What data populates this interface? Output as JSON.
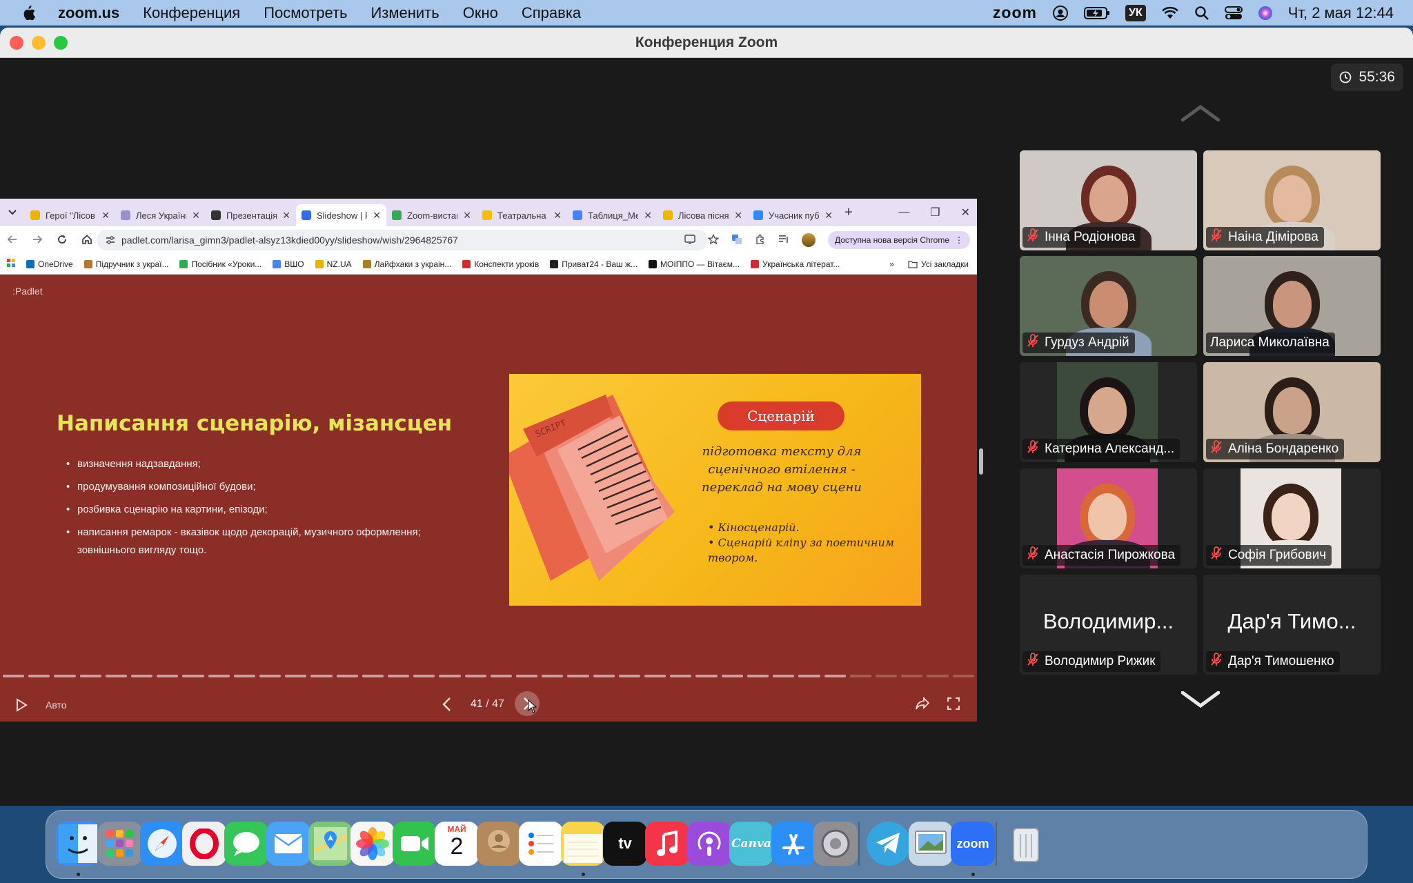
{
  "menubar": {
    "app_name": "zoom.us",
    "menu": [
      "Конференция",
      "Посмотреть",
      "Изменить",
      "Окно",
      "Справка"
    ],
    "status": {
      "zoom_label": "zoom",
      "keyboard": "УК",
      "datetime": "Чт, 2 мая  12:44"
    }
  },
  "window": {
    "title": "Конференция Zoom",
    "timer": "55:36"
  },
  "chrome": {
    "tabs": [
      {
        "title": "Герої \"Лісов",
        "color": "#f0b400",
        "active": false
      },
      {
        "title": "Леся Українк",
        "color": "#9a8fd0",
        "active": false
      },
      {
        "title": "Презентація",
        "color": "#333333",
        "active": false
      },
      {
        "title": "Slideshow | P",
        "color": "#2e6ee6",
        "active": true
      },
      {
        "title": "Zoom-вистав",
        "color": "#34a853",
        "active": false
      },
      {
        "title": "Театральна",
        "color": "#fbbc04",
        "active": false
      },
      {
        "title": "Таблиця_Ме",
        "color": "#4285f4",
        "active": false
      },
      {
        "title": "Лісова пісня",
        "color": "#f4b400",
        "active": false
      },
      {
        "title": "Учасник пуб",
        "color": "#2d8cff",
        "active": false
      }
    ],
    "url": "padlet.com/larisa_gimn3/padlet-alsyz13kdied00yy/slideshow/wish/2964825767",
    "update_chip": "Доступна нова версія Chrome",
    "bookmarks": [
      {
        "label": "OneDrive",
        "color": "#0f6cbd"
      },
      {
        "label": "Підручник з украї...",
        "color": "#b07a2a"
      },
      {
        "label": "Посібник «Уроки...",
        "color": "#34a853"
      },
      {
        "label": "ВШО",
        "color": "#4285f4"
      },
      {
        "label": "NZ.UA",
        "color": "#e8b400"
      },
      {
        "label": "Лайфхаки з украін...",
        "color": "#b07a2a"
      },
      {
        "label": "Конспекти уроків",
        "color": "#d12b2b"
      },
      {
        "label": "Приват24 - Ваш ж...",
        "color": "#222222"
      },
      {
        "label": "МОІППО — Вітаєм...",
        "color": "#111111"
      },
      {
        "label": "Українська літерат...",
        "color": "#d12b2b"
      }
    ],
    "bookmarks_all": "Усі закладки"
  },
  "slide": {
    "logo": ":Padlet",
    "heading": "Написання сценарію, мізансцен",
    "bullets": [
      "визначення надзавдання;",
      "продумування композиційної будови;",
      "розбивка сценарію на картини, епізоди;",
      "написання ремарок - вказівок щодо декорацій, музичного оформлення; зовнішнього вигляду тощо."
    ],
    "image": {
      "script_label": "SCRIPT",
      "badge": "Сценарій",
      "text": "підготовка тексту для сценічного втілення - переклад на мову сцени",
      "list": [
        "Кіносценарій.",
        "Сценарій кліпу за поетичним твором."
      ]
    },
    "auto_label": "Авто",
    "current": "41",
    "separator": " / ",
    "total": "47",
    "progress": 0.87
  },
  "participants": [
    {
      "name": "Інна Родіонова",
      "muted": true,
      "bg": "#cfcac6",
      "skin": "#d9a58c",
      "hair": "#6b2a22",
      "shirt": "#3d2a2a"
    },
    {
      "name": "Наіна Дімірова",
      "muted": true,
      "bg": "#d8c9bb",
      "skin": "#e3b9a0",
      "hair": "#b98a5a",
      "shirt": "#d9d0c8"
    },
    {
      "name": "Гурдуз Андрій",
      "muted": true,
      "bg": "#5c6a58",
      "skin": "#c98e72",
      "hair": "#3a2a22",
      "shirt": "#8da0b8"
    },
    {
      "name": "Лариса Миколаївна",
      "muted": false,
      "bg": "#a8a39a",
      "skin": "#c9957c",
      "hair": "#2e211c",
      "shirt": "#1f2230",
      "active": true
    },
    {
      "name": "Катерина Александ...",
      "muted": true,
      "bg": "#262626",
      "skin": "#d7a78c",
      "hair": "#1c1414",
      "shirt": "#101010",
      "photo": true,
      "photo_bg": "#3b4a3a"
    },
    {
      "name": "Аліна Бондаренко",
      "muted": true,
      "bg": "#cbb8a6",
      "skin": "#caa189",
      "hair": "#2c1d18",
      "shirt": "#9c8f84"
    },
    {
      "name": "Анастасія Пирожкова",
      "muted": true,
      "bg": "#262626",
      "skin": "#f0c4a8",
      "hair": "#d8683a",
      "shirt": "#3a2438",
      "photo": true,
      "photo_bg": "#d34e8c"
    },
    {
      "name": "Софія Грибович",
      "muted": true,
      "bg": "#262626",
      "skin": "#f2d4c4",
      "hair": "#3a2218",
      "shirt": "#ece6e2",
      "photo": true,
      "photo_bg": "#e9e4e0"
    },
    {
      "name": "Володимир Рижик",
      "muted": true,
      "big": "Володимир..."
    },
    {
      "name": "Дар'я Тимошенко",
      "muted": true,
      "big": "Дар'я Тимо..."
    }
  ],
  "dock": {
    "calendar_month": "МАЙ",
    "calendar_day": "2",
    "tv_label": "tv",
    "canva_label": "Canva",
    "zoom_label": "zoom",
    "apps": [
      {
        "name": "finder-icon",
        "color": "#3d8ef0",
        "running": true
      },
      {
        "name": "launchpad-icon",
        "color": "#8a8f9c",
        "running": false
      },
      {
        "name": "safari-icon",
        "color": "#2b8ff5",
        "running": false
      },
      {
        "name": "opera-icon",
        "color": "#f0f0f0",
        "running": false
      },
      {
        "name": "messages-icon",
        "color": "#35c659",
        "running": false
      },
      {
        "name": "mail-icon",
        "color": "#4aa3f7",
        "running": false
      },
      {
        "name": "maps-icon",
        "color": "#7ec77a",
        "running": false
      },
      {
        "name": "photos-icon",
        "color": "#f6f6f6",
        "running": false
      },
      {
        "name": "facetime-icon",
        "color": "#33c24d",
        "running": false
      },
      {
        "name": "calendar-icon",
        "color": "#ffffff",
        "running": false
      },
      {
        "name": "contacts-icon",
        "color": "#b48a5c",
        "running": false
      },
      {
        "name": "reminders-icon",
        "color": "#ffffff",
        "running": false
      },
      {
        "name": "notes-icon",
        "color": "#f7d54b",
        "running": true
      },
      {
        "name": "apple-tv-icon",
        "color": "#111111",
        "running": false
      },
      {
        "name": "music-icon",
        "color": "#f5344a",
        "running": false
      },
      {
        "name": "podcasts-icon",
        "color": "#9b4bdc",
        "running": false
      },
      {
        "name": "canva-icon",
        "color": "#4ac0d6",
        "running": false
      },
      {
        "name": "app-store-icon",
        "color": "#2b8ff5",
        "running": false
      },
      {
        "name": "system-settings-icon",
        "color": "#8e8e93",
        "running": false
      },
      {
        "name": "telegram-icon",
        "color": "#35a5e0",
        "running": false
      },
      {
        "name": "preview-icon",
        "color": "#c9d8e6",
        "running": false
      },
      {
        "name": "zoom-icon",
        "color": "#2d6ff5",
        "running": true
      },
      {
        "name": "trash-icon",
        "color": "#d8dde3",
        "running": false
      }
    ]
  }
}
